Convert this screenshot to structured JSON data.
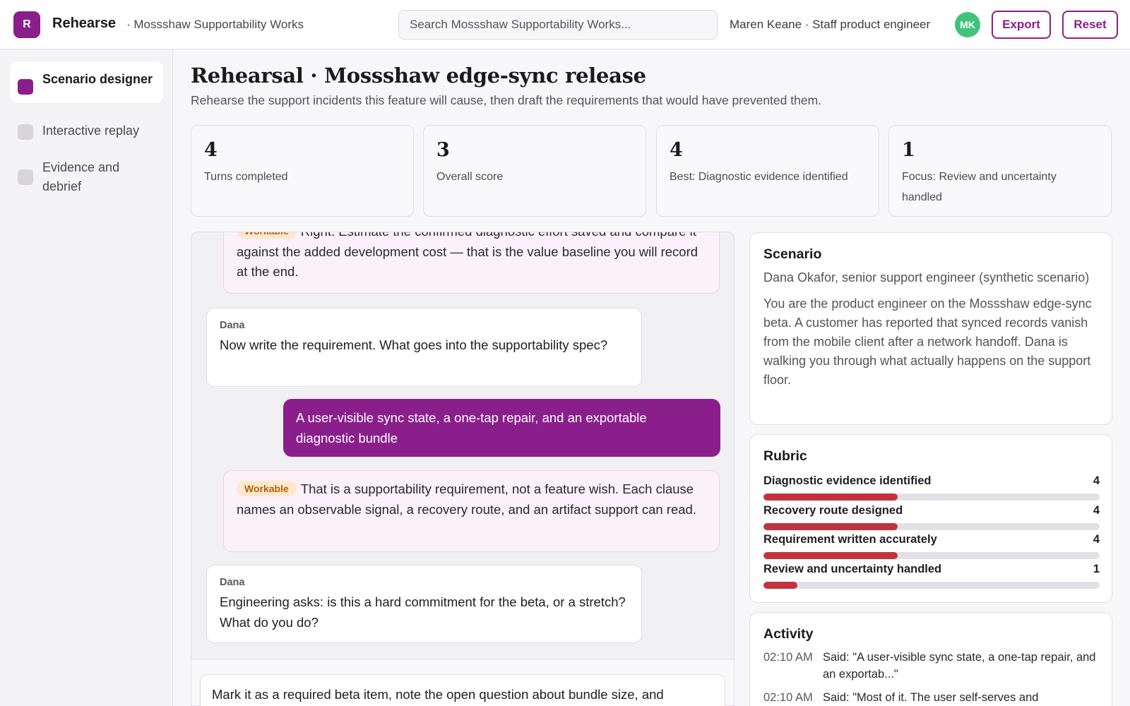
{
  "app": {
    "logo_letter": "R",
    "name": "Rehearse",
    "workspace": "· Mossshaw Supportability Works",
    "brand_color": "#8a1f8c"
  },
  "search": {
    "placeholder": "Search Mossshaw Supportability Works..."
  },
  "user": {
    "name": "Maren Keane · Staff product engineer",
    "initials": "MK",
    "avatar_color": "#3fc47a"
  },
  "toolbar": {
    "export_label": "Export",
    "reset_label": "Reset"
  },
  "sidebar": {
    "items": [
      {
        "label": "Scenario designer",
        "active": true
      },
      {
        "label": "Interactive replay",
        "active": false
      },
      {
        "label": "Evidence and debrief",
        "active": false
      }
    ]
  },
  "page": {
    "title": "Rehearsal · Mossshaw edge-sync release",
    "subtitle": "Rehearse the support incidents this feature will cause, then draft the requirements that would have prevented them."
  },
  "stats": [
    {
      "value": "4",
      "label": "Turns completed"
    },
    {
      "value": "3",
      "label": "Overall score"
    },
    {
      "value": "4",
      "label": "Best: Diagnostic evidence identified"
    },
    {
      "value": "1",
      "label": "Focus: Review and uncertainty handled"
    }
  ],
  "transcript": {
    "messages": [
      {
        "role": "coach",
        "tag": "Workable",
        "text": "Right. Estimate the confirmed diagnostic effort saved and compare it against the added development cost — that is the value baseline you will record at the end."
      },
      {
        "role": "dana",
        "speaker": "Dana",
        "text": "Now write the requirement. What goes into the supportability spec?"
      },
      {
        "role": "user",
        "text": "A user-visible sync state, a one-tap repair, and an exportable diagnostic bundle"
      },
      {
        "role": "coach",
        "tag": "Workable",
        "text": "That is a supportability requirement, not a feature wish. Each clause names an observable signal, a recovery route, and an artifact support can read."
      },
      {
        "role": "dana",
        "speaker": "Dana",
        "text": "Engineering asks: is this a hard commitment for the beta, or a stretch? What do you do?"
      }
    ],
    "composer_value": "Mark it as a required beta item, note the open question about bundle size, and"
  },
  "scenario": {
    "title": "Scenario",
    "who": "Dana Okafor, senior support engineer (synthetic scenario)",
    "body": "You are the product engineer on the Mossshaw edge-sync beta. A customer has reported that synced records vanish from the mobile client after a network handoff. Dana is walking you through what actually happens on the support floor."
  },
  "rubric": {
    "title": "Rubric",
    "max_score": 10,
    "fill_color": "#c0343e",
    "items": [
      {
        "label": "Diagnostic evidence identified",
        "score": 4
      },
      {
        "label": "Recovery route designed",
        "score": 4
      },
      {
        "label": "Requirement written accurately",
        "score": 4
      },
      {
        "label": "Review and uncertainty handled",
        "score": 1
      }
    ]
  },
  "activity": {
    "title": "Activity",
    "items": [
      {
        "time": "02:10 AM",
        "text": "Said: \"A user-visible sync state, a one-tap repair, and an exportab...\""
      },
      {
        "time": "02:10 AM",
        "text": "Said: \"Most of it. The user self-serves and"
      }
    ]
  }
}
